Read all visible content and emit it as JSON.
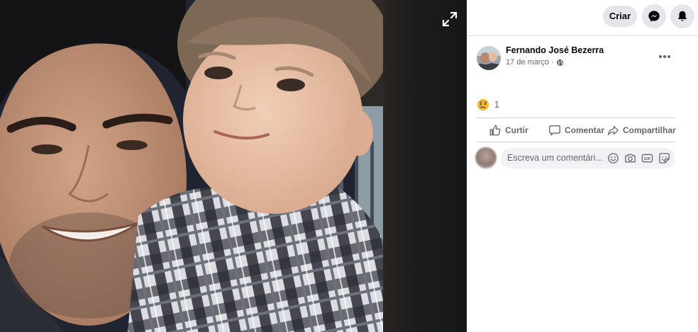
{
  "header": {
    "create_label": "Criar",
    "messenger_icon": "messenger-icon",
    "notifications_icon": "bell-icon"
  },
  "viewer": {
    "expand_icon": "expand-icon"
  },
  "post": {
    "author": "Fernando José Bezerra",
    "date": "17 de março",
    "date_separator": "·",
    "privacy_icon": "globe-icon",
    "more_icon": "more-options-icon",
    "reaction_icon": "sad-reaction-icon",
    "reaction_count": "1"
  },
  "actions": [
    {
      "label": "Curtir",
      "icon": "like-icon"
    },
    {
      "label": "Comentar",
      "icon": "comment-icon"
    },
    {
      "label": "Compartilhar",
      "icon": "share-icon"
    }
  ],
  "comment_box": {
    "placeholder": "Escreva um comentári...",
    "gif_label": "GIF",
    "icons": [
      "emoji-icon",
      "camera-icon",
      "gif-icon",
      "sticker-icon"
    ]
  },
  "colors": {
    "panel_bg": "#ffffff",
    "viewer_bg": "#161718",
    "button_bg": "#e4e6eb",
    "input_bg": "#f0f2f5",
    "text_primary": "#050505",
    "text_secondary": "#65676b",
    "reaction": "#f7b928"
  }
}
